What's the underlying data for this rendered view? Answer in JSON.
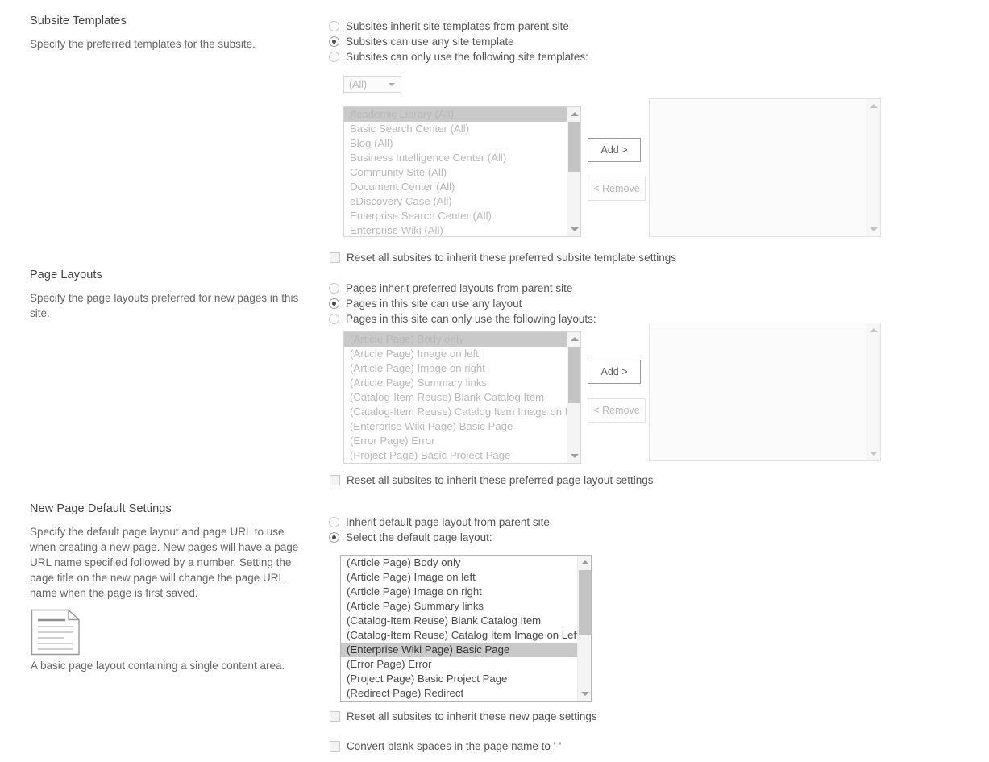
{
  "sections": [
    {
      "id": "subsite-templates",
      "title": "Subsite Templates",
      "description": "Specify the preferred templates for the subsite.",
      "radios": [
        {
          "label": "Subsites inherit site templates from parent site",
          "checked": false
        },
        {
          "label": "Subsites can use any site template",
          "checked": true
        },
        {
          "label": "Subsites can only use the following site templates:",
          "checked": false
        }
      ],
      "dropdown": {
        "value": "(All)",
        "options": [
          "(All)"
        ]
      },
      "available_list": {
        "enabled": false,
        "items": [
          "Academic Library (All)",
          "Basic Search Center (All)",
          "Blog (All)",
          "Business Intelligence Center (All)",
          "Community Site (All)",
          "Document Center (All)",
          "eDiscovery Case (All)",
          "Enterprise Search Center (All)",
          "Enterprise Wiki (All)"
        ],
        "selected_index": 0
      },
      "add_button": "Add >",
      "remove_button": "< Remove",
      "selected_list": {
        "items": []
      },
      "reset_checkbox": {
        "label": "Reset all subsites to inherit these preferred subsite template settings",
        "checked": false
      }
    },
    {
      "id": "page-layouts",
      "title": "Page Layouts",
      "description": "Specify the page layouts preferred for new pages in this site.",
      "radios": [
        {
          "label": "Pages inherit preferred layouts from parent site",
          "checked": false
        },
        {
          "label": "Pages in this site can use any layout",
          "checked": true
        },
        {
          "label": "Pages in this site can only use the following layouts:",
          "checked": false
        }
      ],
      "available_list": {
        "enabled": false,
        "items": [
          "(Article Page) Body only",
          "(Article Page) Image on left",
          "(Article Page) Image on right",
          "(Article Page) Summary links",
          "(Catalog-Item Reuse) Blank Catalog Item",
          "(Catalog-Item Reuse) Catalog Item Image on Left",
          "(Enterprise Wiki Page) Basic Page",
          "(Error Page) Error",
          "(Project Page) Basic Project Page"
        ],
        "selected_index": 0
      },
      "add_button": "Add >",
      "remove_button": "< Remove",
      "selected_list": {
        "items": []
      },
      "reset_checkbox": {
        "label": "Reset all subsites to inherit these preferred page layout settings",
        "checked": false
      }
    },
    {
      "id": "new-page-default-settings",
      "title": "New Page Default Settings",
      "description": "Specify the default page layout and page URL to use when creating a new page. New pages will have a page URL name specified followed by a number. Setting the page title on the new page will change the page URL name when the page is first saved.",
      "preview_caption": "A basic page layout containing a single content area.",
      "preview_icon": "page-layout-thumbnail-icon",
      "radios": [
        {
          "label": "Inherit default page layout from parent site",
          "checked": false
        },
        {
          "label": "Select the default page layout:",
          "checked": true
        }
      ],
      "default_layout_list": {
        "enabled": true,
        "items": [
          "(Article Page) Body only",
          "(Article Page) Image on left",
          "(Article Page) Image on right",
          "(Article Page) Summary links",
          "(Catalog-Item Reuse) Blank Catalog Item",
          "(Catalog-Item Reuse) Catalog Item Image on Left",
          "(Enterprise Wiki Page) Basic Page",
          "(Error Page) Error",
          "(Project Page) Basic Project Page",
          "(Redirect Page) Redirect"
        ],
        "selected_index": 6
      },
      "reset_checkbox": {
        "label": "Reset all subsites to inherit these new page settings",
        "checked": false
      },
      "convert_checkbox": {
        "label": "Convert blank spaces in the page name to '-'",
        "checked": false
      }
    }
  ],
  "colors": {
    "text": "#444444",
    "muted": "#666666",
    "disabled": "#b9b9b9",
    "selection": "#c9c9c9",
    "border": "#d6d6d6"
  }
}
